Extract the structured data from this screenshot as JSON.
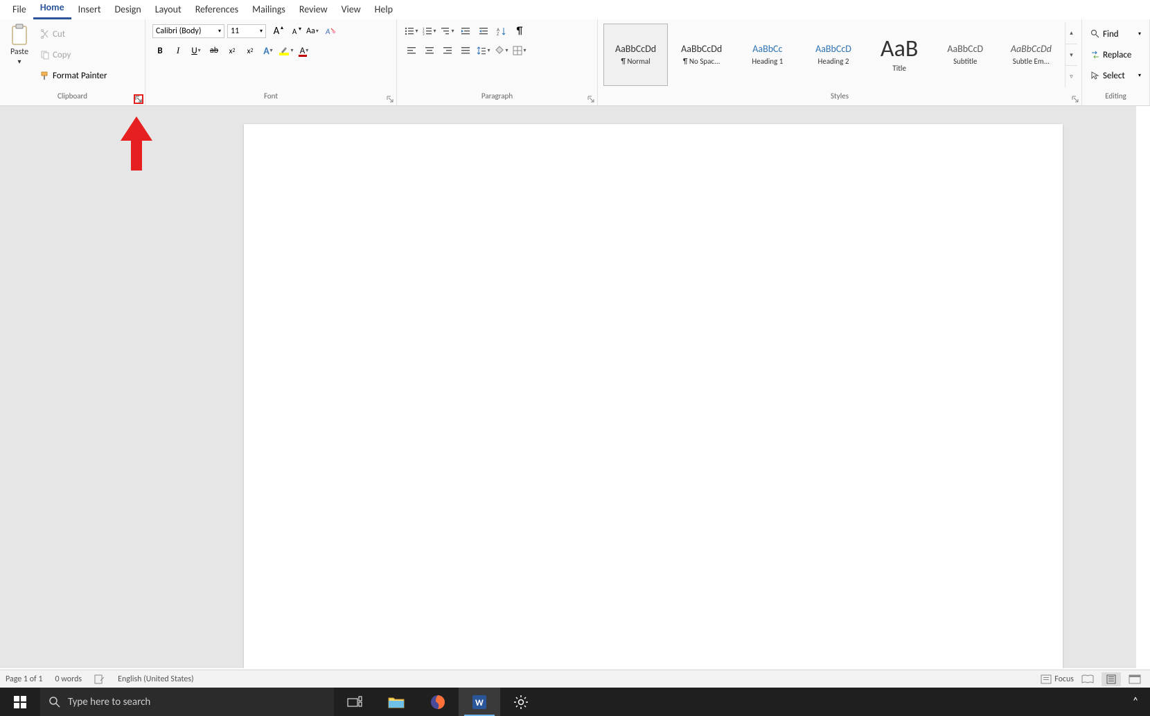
{
  "tabs": {
    "file": "File",
    "home": "Home",
    "insert": "Insert",
    "design": "Design",
    "layout": "Layout",
    "references": "References",
    "mailings": "Mailings",
    "review": "Review",
    "view": "View",
    "help": "Help"
  },
  "clipboard": {
    "label": "Clipboard",
    "paste": "Paste",
    "cut": "Cut",
    "copy": "Copy",
    "format_painter": "Format Painter"
  },
  "font": {
    "label": "Font",
    "name": "Calibri (Body)",
    "size": "11"
  },
  "paragraph": {
    "label": "Paragraph"
  },
  "styles": {
    "label": "Styles",
    "items": [
      {
        "preview": "AaBbCcDd",
        "name": "¶ Normal",
        "cls": ""
      },
      {
        "preview": "AaBbCcDd",
        "name": "¶ No Spac...",
        "cls": ""
      },
      {
        "preview": "AaBbCc",
        "name": "Heading 1",
        "cls": "h1"
      },
      {
        "preview": "AaBbCcD",
        "name": "Heading 2",
        "cls": "h2"
      },
      {
        "preview": "AaB",
        "name": "Title",
        "cls": "title"
      },
      {
        "preview": "AaBbCcD",
        "name": "Subtitle",
        "cls": "sub"
      },
      {
        "preview": "AaBbCcDd",
        "name": "Subtle Em...",
        "cls": "em"
      }
    ]
  },
  "editing": {
    "label": "Editing",
    "find": "Find",
    "replace": "Replace",
    "select": "Select"
  },
  "status": {
    "page": "Page 1 of 1",
    "words": "0 words",
    "lang": "English (United States)",
    "focus": "Focus"
  },
  "taskbar": {
    "search_placeholder": "Type here to search"
  }
}
